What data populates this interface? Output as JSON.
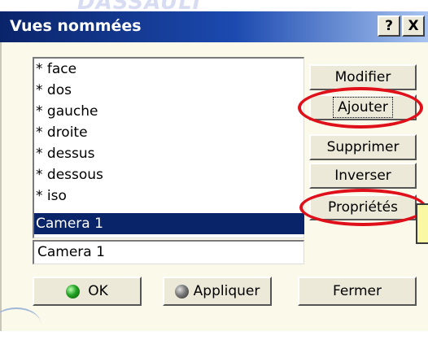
{
  "background_text": "DASSAULT",
  "dialog": {
    "title": "Vues nommées",
    "help_button": "?",
    "close_button": "X"
  },
  "views_list": {
    "items": [
      {
        "label": "* face"
      },
      {
        "label": "* dos"
      },
      {
        "label": "* gauche"
      },
      {
        "label": "* droite"
      },
      {
        "label": "* dessus"
      },
      {
        "label": "* dessous"
      },
      {
        "label": "* iso"
      },
      {
        "label": "Camera  1",
        "selected": true
      }
    ]
  },
  "name_field": {
    "value": "Camera  1"
  },
  "side_buttons": {
    "modify": "Modifier",
    "add": "Ajouter",
    "delete": "Supprimer",
    "reverse": "Inverser",
    "properties": "Propriétés"
  },
  "bottom_buttons": {
    "ok": "OK",
    "apply": "Appliquer",
    "close": "Fermer"
  },
  "colors": {
    "title_bar": "#0a246a",
    "selection": "#0a246a",
    "dialog_bg": "#fbf9e9",
    "annotation": "#e0101a",
    "note": "#fbf8a4"
  }
}
